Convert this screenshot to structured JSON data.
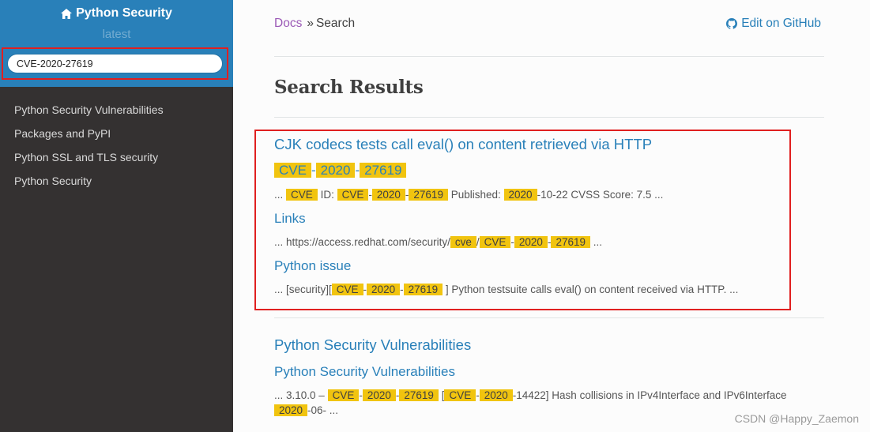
{
  "sidebar": {
    "project_name": "Python Security",
    "version": "latest",
    "search_value": "CVE-2020-27619",
    "items": [
      {
        "label": "Python Security Vulnerabilities"
      },
      {
        "label": "Packages and PyPI"
      },
      {
        "label": "Python SSL and TLS security"
      },
      {
        "label": "Python Security"
      }
    ]
  },
  "breadcrumb": {
    "docs": "Docs",
    "separator": "»",
    "current": "Search",
    "edit_label": "Edit on GitHub"
  },
  "page": {
    "title": "Search Results"
  },
  "results": {
    "r1_title": "CJK codecs tests call eval() on content retrieved via HTTP",
    "r1_sub": [
      "CVE",
      "-",
      "2020",
      "-",
      "27619"
    ],
    "r1_snip": [
      "...",
      "CVE",
      "ID:",
      "CVE",
      "-",
      "2020",
      "-",
      "27619",
      "Published:",
      "2020",
      "-10-22 CVSS Score: 7.5 ..."
    ],
    "r1_links": "Links",
    "r1_links_snip": [
      "... https://access.redhat.com/security/",
      "cve",
      "/",
      "CVE",
      "-",
      "2020",
      "-",
      "27619",
      "..."
    ],
    "r1_issue": "Python issue",
    "r1_issue_snip": [
      "... [security][",
      "CVE",
      "-",
      "2020",
      "-",
      "27619",
      "] Python testsuite calls eval() on content received via HTTP. ..."
    ],
    "r2_title": "Python Security Vulnerabilities",
    "r2_sub": "Python Security Vulnerabilities",
    "r2_snip": [
      "... 3.10.0 –",
      "CVE",
      "-",
      "2020",
      "-",
      "27619",
      "[",
      "CVE",
      "-",
      "2020",
      "-14422] Hash collisions in IPv4Interface and IPv6Interface"
    ],
    "r2_snip2": [
      "2020",
      "-06- ..."
    ]
  },
  "watermark": "CSDN @Happy_Zaemon",
  "colors": {
    "sidebar_top": "#2980b9",
    "sidebar_bg": "#343131",
    "link": "#2980b9",
    "highlight": "#f1c40f",
    "annotation_box": "#e02020"
  }
}
